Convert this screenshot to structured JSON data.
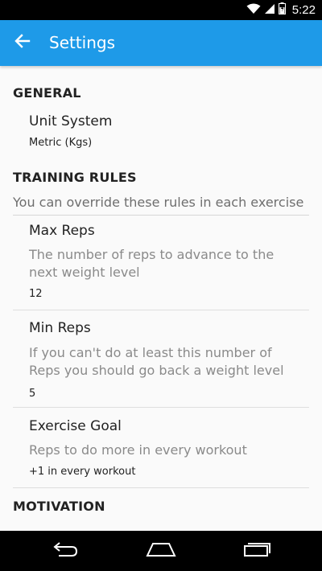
{
  "status_bar": {
    "time": "5:22",
    "icons": [
      "wifi-icon",
      "signal-icon",
      "battery-icon"
    ]
  },
  "app_bar": {
    "title": "Settings",
    "back_icon": "arrow-left-icon",
    "background_color": "#1e9ae8"
  },
  "sections": {
    "general": {
      "header": "GENERAL",
      "unit_system": {
        "title": "Unit System",
        "value": "Metric (Kgs)"
      }
    },
    "training_rules": {
      "header": "TRAINING RULES",
      "description": "You can override these rules in each exercise",
      "max_reps": {
        "title": "Max Reps",
        "summary": "The number of reps to advance to the next weight level",
        "value": "12"
      },
      "min_reps": {
        "title": "Min Reps",
        "summary": "If you can't do at least this number of Reps you should go back a weight level",
        "value": "5"
      },
      "exercise_goal": {
        "title": "Exercise Goal",
        "summary": "Reps to do more in every workout",
        "value": "+1 in every workout"
      }
    },
    "motivation": {
      "header": "MOTIVATION"
    }
  },
  "nav_bar": {
    "buttons": [
      "back-nav-icon",
      "home-nav-icon",
      "recents-nav-icon"
    ]
  }
}
